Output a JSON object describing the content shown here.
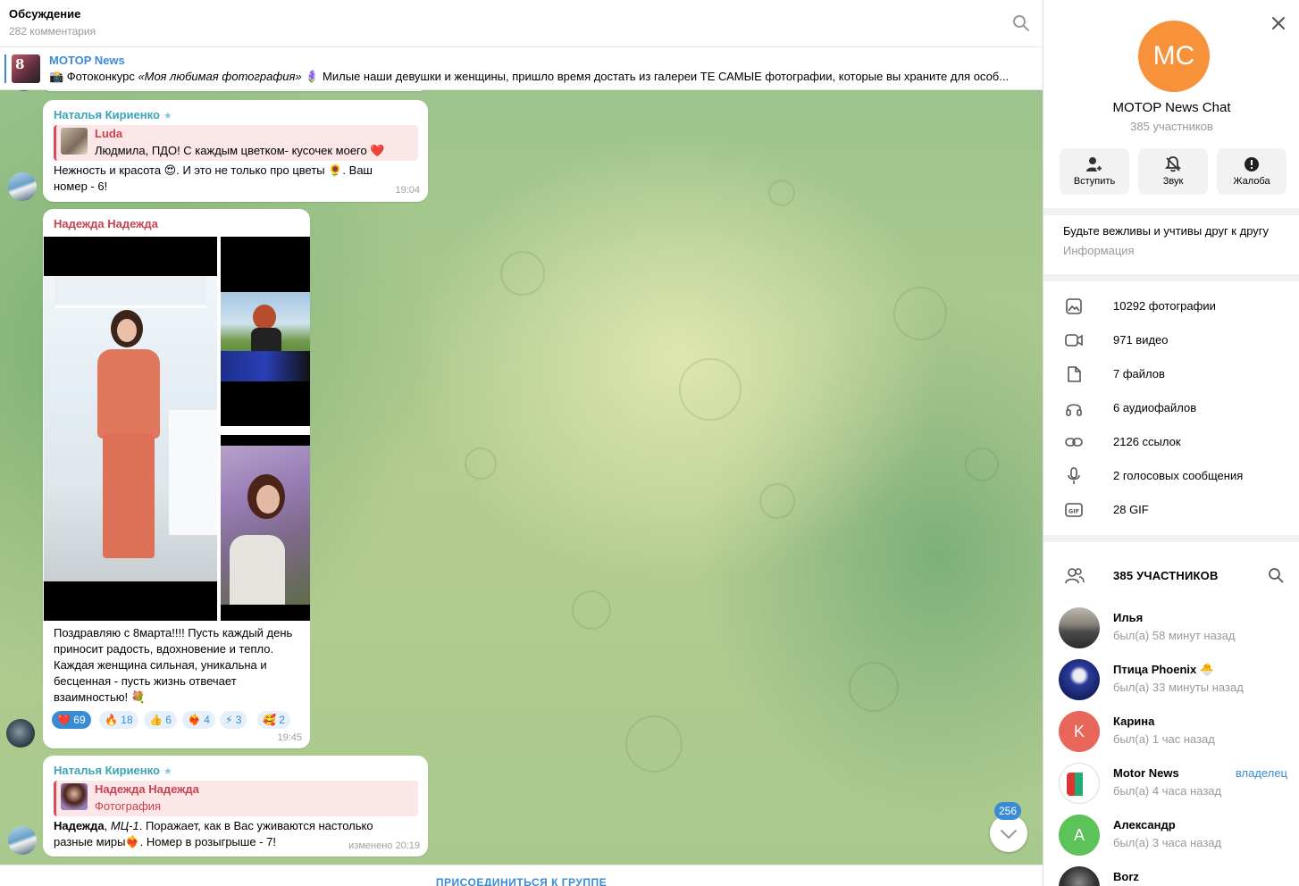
{
  "header": {
    "title": "Обсуждение",
    "subtitle": "282 комментария"
  },
  "pinned": {
    "name": "MOTOP News",
    "thumb_text": "8",
    "text_prefix": "📸 Фотоконкурс ",
    "text_italic": "«Моя любимая фотография»",
    "text_rest": " 🪻 Милые наши девушки и женщины, пришло время достать из галереи ТЕ САМЫЕ фотографии, которые вы храните для особ..."
  },
  "messages": [
    {
      "sender": "Наталья Кириенко",
      "sender_color": "#3aa3b8",
      "reply_name": "Luda",
      "reply_text": "Людмила, ПДО! С каждым цветком- кусочек моего ❤️",
      "text": "Нежность и красота 😍. И это не только про цветы 🌻. Ваш номер - 6!",
      "time": "19:04"
    },
    {
      "sender": "Надежда Надежда",
      "sender_color": "#c9434f",
      "text": "Поздравляю с 8марта!!!! Пусть каждый день приносит радость, вдохновение и тепло. Каждая женщина сильная, уникальна и бесценная - пусть жизнь отвечает взаимностью! 💐",
      "time": "19:45",
      "reactions": [
        {
          "emoji": "❤️",
          "count": "69"
        },
        {
          "emoji": "🔥",
          "count": "18"
        },
        {
          "emoji": "👍",
          "count": "6"
        },
        {
          "emoji": "❤️‍🔥",
          "count": "4"
        },
        {
          "emoji": "⚡",
          "count": "3"
        },
        {
          "emoji": "🥰",
          "count": "2"
        }
      ]
    },
    {
      "sender": "Наталья Кириенко",
      "sender_color": "#3aa3b8",
      "reply_name": "Надежда Надежда",
      "reply_text": "Фотография",
      "text_bold": "Надежда",
      "text_italic": "МЦ-1",
      "text_rest": ". Поражает, как в Вас уживаются настолько разные миры❤️‍🔥. Номер в розыгрыше - 7!",
      "time": "изменено 20:19"
    }
  ],
  "unread_count": "256",
  "join_label": "ПРИСОЕДИНИТЬСЯ К ГРУППЕ",
  "panel": {
    "avatar_initials": "MC",
    "avatar_color": "#f7913a",
    "name": "MOTOP News Chat",
    "count": "385 участников",
    "actions": [
      {
        "label": "Вступить",
        "icon": "add-user-icon"
      },
      {
        "label": "Звук",
        "icon": "mute-icon"
      },
      {
        "label": "Жалоба",
        "icon": "report-icon"
      }
    ],
    "rules": "Будьте вежливы и учтивы друг к другу",
    "rules_label": "Информация",
    "media": [
      {
        "label": "10292 фотографии",
        "icon": "photo-icon"
      },
      {
        "label": "971 видео",
        "icon": "video-icon"
      },
      {
        "label": "7 файлов",
        "icon": "file-icon"
      },
      {
        "label": "6 аудиофайлов",
        "icon": "headphones-icon"
      },
      {
        "label": "2126 ссылок",
        "icon": "link-icon"
      },
      {
        "label": "2 голосовых сообщения",
        "icon": "mic-icon"
      },
      {
        "label": "28 GIF",
        "icon": "gif-icon"
      }
    ],
    "members_title": "385 УЧАСТНИКОВ",
    "members": [
      {
        "name": "Илья",
        "status": "был(а) 58 минут назад",
        "role": ""
      },
      {
        "name": "Птица Phoenix 🐣",
        "status": "был(а) 33 минуты назад",
        "role": ""
      },
      {
        "name": "Карина",
        "status": "был(а) 1 час назад",
        "role": "",
        "initial": "K",
        "color": "#e8665a"
      },
      {
        "name": "Motor News",
        "status": "был(а) 4 часа назад",
        "role": "владелец"
      },
      {
        "name": "Александр",
        "status": "был(а) 3 часа назад",
        "role": "",
        "initial": "A",
        "color": "#5cc25a"
      },
      {
        "name": "Borz",
        "status": "",
        "role": ""
      }
    ]
  }
}
